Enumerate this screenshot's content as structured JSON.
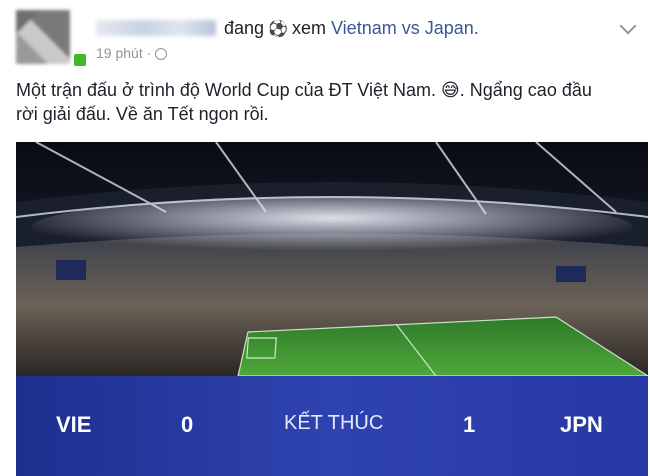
{
  "header": {
    "name_blurred": true,
    "status_verb": "đang",
    "status_emoji": "⚽",
    "action": "xem",
    "activity_link": "Vietnam vs Japan.",
    "time": "19 phút",
    "privacy_icon": "globe-icon"
  },
  "post": {
    "text_line1": "Một trận đấu ở trình độ World Cup của ĐT Việt Nam. 😅. Ngẩng cao đầu",
    "text_line2": "rời giải đấu. Về ăn Tết ngon rồi."
  },
  "score": {
    "home": "VIE",
    "home_score": "0",
    "status": "KẾT THÚC",
    "away_score": "1",
    "away": "JPN"
  },
  "colors": {
    "link": "#385898",
    "scorebar": "#2a3ca8",
    "online": "#42b72a"
  }
}
